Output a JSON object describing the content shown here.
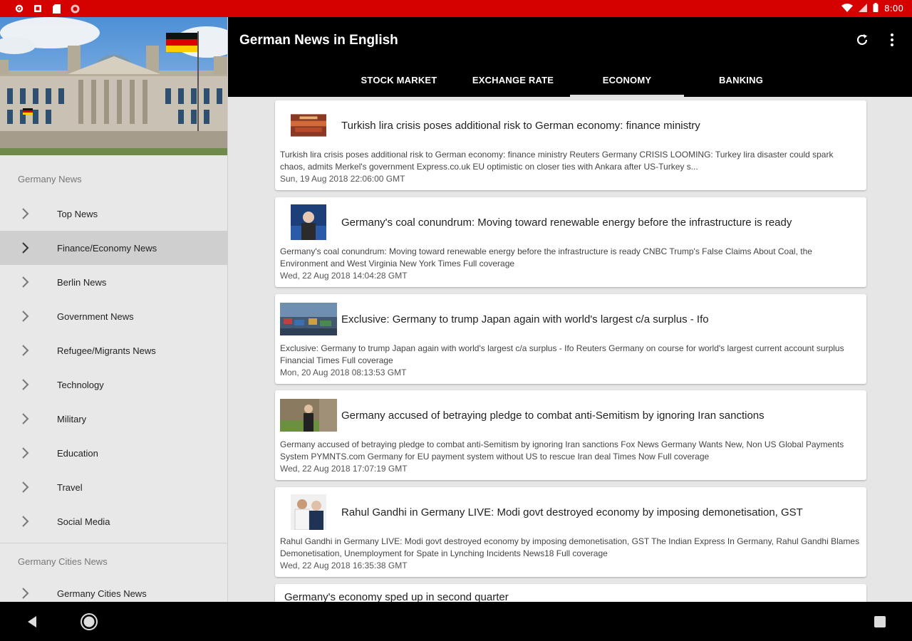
{
  "status_bar": {
    "time": "8:00",
    "bg": "#d50000"
  },
  "app": {
    "title": "German News in English",
    "refresh_icon": "refresh-icon",
    "menu_icon": "more-vert-icon"
  },
  "tabs": [
    {
      "label": "STOCK MARKET",
      "active": false
    },
    {
      "label": "EXCHANGE RATE",
      "active": false
    },
    {
      "label": "ECONOMY",
      "active": true
    },
    {
      "label": "BANKING",
      "active": false
    }
  ],
  "sidebar": {
    "section1": "Germany News",
    "items": [
      {
        "label": "Top News"
      },
      {
        "label": "Finance/Economy News",
        "active": true
      },
      {
        "label": "Berlin News"
      },
      {
        "label": "Government News"
      },
      {
        "label": "Refugee/Migrants News"
      },
      {
        "label": "Technology"
      },
      {
        "label": "Military"
      },
      {
        "label": "Education"
      },
      {
        "label": "Travel"
      },
      {
        "label": "Social Media"
      }
    ],
    "section2": "Germany Cities News",
    "items2": [
      {
        "label": "Germany Cities News"
      }
    ]
  },
  "news": [
    {
      "title": "Turkish lira crisis poses additional risk to German economy: finance ministry",
      "desc": "Turkish lira crisis poses additional risk to German economy: finance ministry  Reuters  Germany CRISIS LOOMING: Turkey lira disaster could spark chaos, admits Merkel's government  Express.co.uk  EU optimistic on closer ties with Ankara after US-Turkey s...",
      "date": "Sun, 19 Aug 2018 22:06:00 GMT"
    },
    {
      "title": "Germany's coal conundrum: Moving toward renewable energy before the infrastructure is ready",
      "desc": "Germany's coal conundrum: Moving toward renewable energy before the infrastructure is ready  CNBC  Trump's False Claims About Coal, the Environment and West Virginia  New York Times  Full coverage",
      "date": "Wed, 22 Aug 2018 14:04:28 GMT"
    },
    {
      "title": "Exclusive: Germany to trump Japan again with world's largest c/a surplus - Ifo",
      "desc": "Exclusive: Germany to trump Japan again with world's largest c/a surplus - Ifo  Reuters  Germany on course for world's largest current account surplus  Financial Times  Full coverage",
      "date": "Mon, 20 Aug 2018 08:13:53 GMT"
    },
    {
      "title": "Germany accused of betraying pledge to combat anti-Semitism by ignoring Iran sanctions",
      "desc": "Germany accused of betraying pledge to combat anti-Semitism by ignoring Iran sanctions  Fox News  Germany Wants New, Non US Global Payments System  PYMNTS.com  Germany for EU payment system without US to rescue Iran deal  Times Now  Full coverage",
      "date": "Wed, 22 Aug 2018 17:07:19 GMT"
    },
    {
      "title": "Rahul Gandhi in Germany LIVE: Modi govt destroyed economy by imposing demonetisation, GST",
      "desc": "Rahul Gandhi in Germany LIVE: Modi govt destroyed economy by imposing demonetisation, GST  The Indian Express  In Germany, Rahul Gandhi Blames Demonetisation, Unemployment for Spate in Lynching Incidents  News18  Full coverage",
      "date": "Wed, 22 Aug 2018 16:35:38 GMT"
    },
    {
      "title": "Germany's economy sped up in second quarter"
    }
  ]
}
